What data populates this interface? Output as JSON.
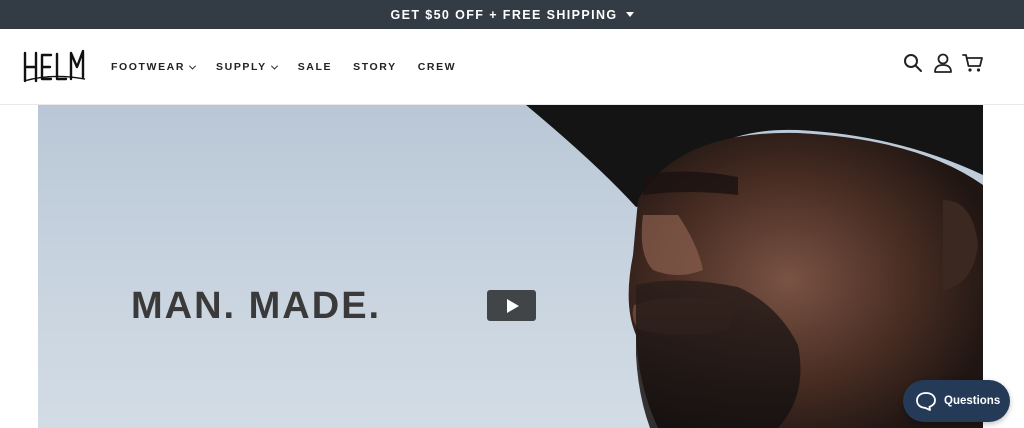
{
  "promo": {
    "text": "GET $50 OFF + FREE SHIPPING"
  },
  "brand": {
    "logo_text": "HELM"
  },
  "nav": {
    "items": [
      {
        "label": "FOOTWEAR",
        "has_dropdown": true
      },
      {
        "label": "SUPPLY",
        "has_dropdown": true
      },
      {
        "label": "SALE",
        "has_dropdown": false
      },
      {
        "label": "STORY",
        "has_dropdown": false
      },
      {
        "label": "CREW",
        "has_dropdown": false
      }
    ]
  },
  "header_icons": [
    "search-icon",
    "account-icon",
    "cart-icon"
  ],
  "hero": {
    "headline": "MAN. MADE."
  },
  "chat": {
    "label": "Questions"
  },
  "colors": {
    "promo_bg": "#333c45",
    "chat_bg": "#243a57",
    "play_bg": "#424548"
  }
}
